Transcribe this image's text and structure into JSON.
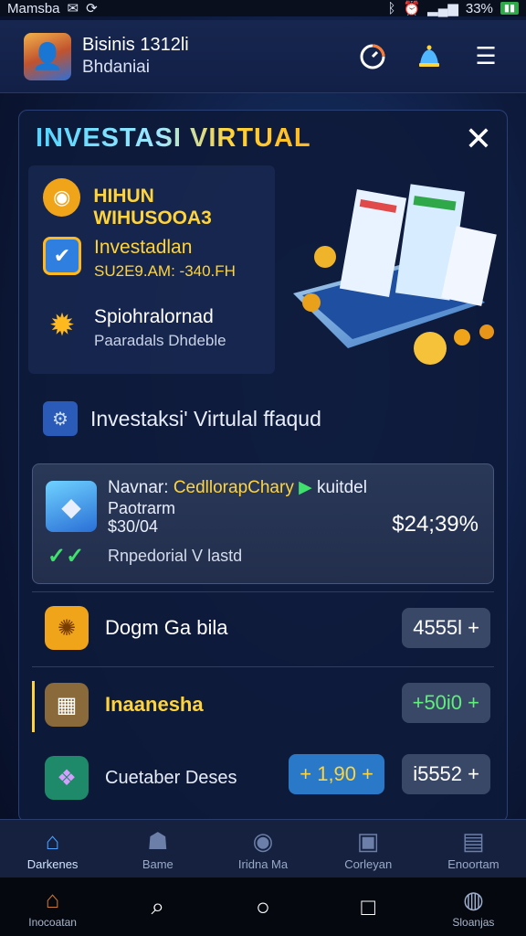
{
  "status_bar": {
    "carrier": "Mamsba",
    "battery_text": "33%",
    "icons": [
      "mail-icon",
      "sync-icon",
      "bluetooth-icon",
      "alarm-icon",
      "signal-icon",
      "battery-icon"
    ]
  },
  "header": {
    "title": "Bisinis 1312li",
    "subtitle": "Bhdaniai",
    "icons": [
      "timer-icon",
      "bell-icon",
      "menu-icon"
    ]
  },
  "panel": {
    "title": "INVESTASI VIRTUAL",
    "features": [
      {
        "main": "HIHUN WIHUSOOA3",
        "sub": "",
        "icon": "coin-icon"
      },
      {
        "main": "Investadlan",
        "sub": "SU2E9.AM: -340.FH",
        "icon": "checkbox-icon"
      },
      {
        "main": "Spiohralornad",
        "sub": "Paaradals Dhdeble",
        "icon": "sun-icon"
      }
    ],
    "link_text": "Investaksi' Virtulal ffaqud",
    "summary": {
      "name_label": "Navnar:",
      "name_highlight": "CedllorapChary",
      "status_arrow": "▶",
      "status_text": "kuitdel",
      "sub1": "Paotrarm",
      "sub2": "$30/04",
      "value": "$24;39%",
      "footer": "Rnpedorial V lastd"
    },
    "items": [
      {
        "label": "Dogm Ga bila",
        "pill": "4555l +",
        "icon": "medal-icon"
      },
      {
        "label": "Inaanesha",
        "pill": "+50i0 +",
        "icon": "register-icon"
      },
      {
        "label": "Cuetaber Deses",
        "pill_a": "+ 1,90 +",
        "pill_b": "i5552 +",
        "icon": "gem-icon"
      }
    ],
    "colors": {
      "accent_yellow": "#ffd43b",
      "accent_green": "#3fe06c",
      "accent_blue": "#4aa3ff"
    }
  },
  "bottom_nav": [
    {
      "label": "Darkenes",
      "icon": "home-icon",
      "active": true
    },
    {
      "label": "Bame",
      "icon": "robot-icon",
      "active": false
    },
    {
      "label": "Iridna Ma",
      "icon": "chevron-circle-icon",
      "active": false
    },
    {
      "label": "Corleyan",
      "icon": "printer-icon",
      "active": false
    },
    {
      "label": "Enoortam",
      "icon": "chart-icon",
      "active": false
    }
  ],
  "system_nav": [
    {
      "label": "Inocoatan",
      "icon": "home-icon"
    },
    {
      "label": "",
      "icon": "search-icon"
    },
    {
      "label": "",
      "icon": "circle-home-icon"
    },
    {
      "label": "",
      "icon": "square-recent-icon"
    },
    {
      "label": "Sloanjas",
      "icon": "chat-icon"
    }
  ]
}
